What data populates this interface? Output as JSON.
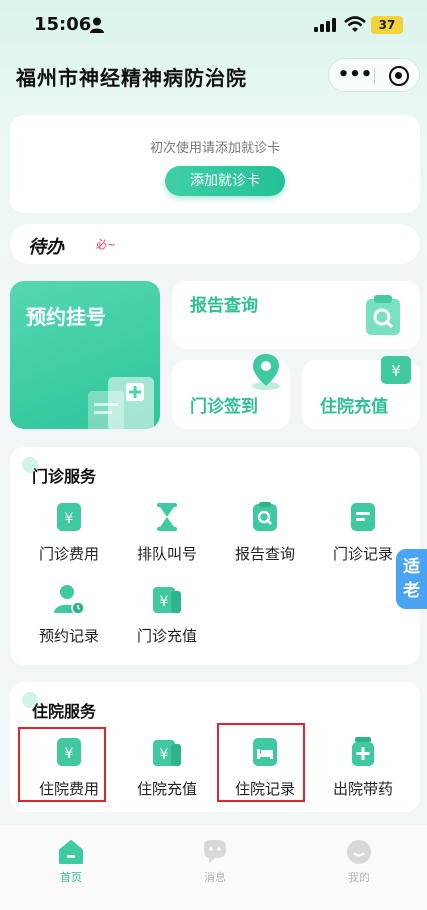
{
  "status_bar": {
    "time": "15:06",
    "battery": "37"
  },
  "header": {
    "title": "福州市神经精神病防治院",
    "more_label": "•••"
  },
  "add_card": {
    "hint": "初次使用请添加就诊卡",
    "button_label": "添加就诊卡"
  },
  "todo": {
    "title": "待办",
    "mark": "必~"
  },
  "quick": {
    "appointment_label": "预约挂号",
    "report_label": "报告查询",
    "checkin_label": "门诊签到",
    "inpatient_recharge_label": "住院充值"
  },
  "outpatient": {
    "title": "门诊服务",
    "items": [
      {
        "label": "门诊费用",
        "icon": "yuan-doc-icon"
      },
      {
        "label": "排队叫号",
        "icon": "hourglass-icon"
      },
      {
        "label": "报告查询",
        "icon": "report-search-icon"
      },
      {
        "label": "门诊记录",
        "icon": "record-icon"
      },
      {
        "label": "预约记录",
        "icon": "person-clock-icon"
      },
      {
        "label": "门诊充值",
        "icon": "yuan-recharge-icon"
      }
    ]
  },
  "inpatient": {
    "title": "住院服务",
    "items": [
      {
        "label": "住院费用",
        "icon": "yuan-doc-icon"
      },
      {
        "label": "住院充值",
        "icon": "yuan-recharge-icon"
      },
      {
        "label": "住院记录",
        "icon": "bed-icon"
      },
      {
        "label": "出院带药",
        "icon": "medicine-icon"
      }
    ]
  },
  "elder_mode": {
    "label_line1": "适",
    "label_line2": "老"
  },
  "tabbar": {
    "home": "首页",
    "messages": "消息",
    "mine": "我的"
  },
  "colors": {
    "accent": "#2fbf95",
    "highlight": "#e0252b",
    "elder": "#4aa3f3"
  }
}
